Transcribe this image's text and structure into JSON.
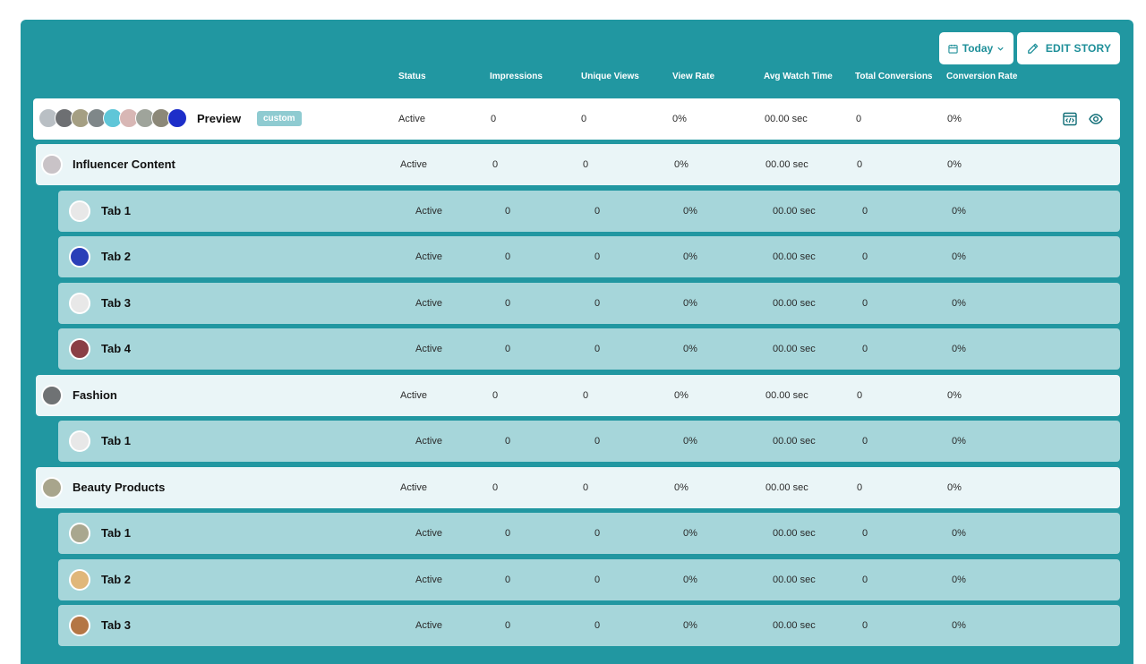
{
  "toolbar": {
    "date_label": "Today",
    "edit_label": "EDIT STORY"
  },
  "columns": [
    "Status",
    "Impressions",
    "Unique Views",
    "View Rate",
    "Avg Watch Time",
    "Total Conversions",
    "Conversion Rate"
  ],
  "colors": {
    "panel": "#2197a1",
    "group_row": "#eaf5f7",
    "tab_row": "#a6d6da",
    "accent": "#1e8f99"
  },
  "preview": {
    "name": "Preview",
    "badge": "custom",
    "status": "Active",
    "impressions": "0",
    "unique_views": "0",
    "view_rate": "0%",
    "avg_watch": "00.00 sec",
    "total_conv": "0",
    "conv_rate": "0%"
  },
  "rows": [
    {
      "kind": "group",
      "name": "Influencer Content",
      "status": "Active",
      "impressions": "0",
      "unique_views": "0",
      "view_rate": "0%",
      "avg_watch": "00.00 sec",
      "total_conv": "0",
      "conv_rate": "0%"
    },
    {
      "kind": "tab",
      "name": "Tab 1",
      "status": "Active",
      "impressions": "0",
      "unique_views": "0",
      "view_rate": "0%",
      "avg_watch": "00.00 sec",
      "total_conv": "0",
      "conv_rate": "0%"
    },
    {
      "kind": "tab",
      "name": "Tab 2",
      "status": "Active",
      "impressions": "0",
      "unique_views": "0",
      "view_rate": "0%",
      "avg_watch": "00.00 sec",
      "total_conv": "0",
      "conv_rate": "0%"
    },
    {
      "kind": "tab",
      "name": "Tab 3",
      "status": "Active",
      "impressions": "0",
      "unique_views": "0",
      "view_rate": "0%",
      "avg_watch": "00.00 sec",
      "total_conv": "0",
      "conv_rate": "0%"
    },
    {
      "kind": "tab",
      "name": "Tab 4",
      "status": "Active",
      "impressions": "0",
      "unique_views": "0",
      "view_rate": "0%",
      "avg_watch": "00.00 sec",
      "total_conv": "0",
      "conv_rate": "0%"
    },
    {
      "kind": "group",
      "name": "Fashion",
      "status": "Active",
      "impressions": "0",
      "unique_views": "0",
      "view_rate": "0%",
      "avg_watch": "00.00 sec",
      "total_conv": "0",
      "conv_rate": "0%"
    },
    {
      "kind": "tab",
      "name": "Tab 1",
      "status": "Active",
      "impressions": "0",
      "unique_views": "0",
      "view_rate": "0%",
      "avg_watch": "00.00 sec",
      "total_conv": "0",
      "conv_rate": "0%"
    },
    {
      "kind": "group",
      "name": "Beauty Products",
      "status": "Active",
      "impressions": "0",
      "unique_views": "0",
      "view_rate": "0%",
      "avg_watch": "00.00 sec",
      "total_conv": "0",
      "conv_rate": "0%"
    },
    {
      "kind": "tab",
      "name": "Tab 1",
      "status": "Active",
      "impressions": "0",
      "unique_views": "0",
      "view_rate": "0%",
      "avg_watch": "00.00 sec",
      "total_conv": "0",
      "conv_rate": "0%"
    },
    {
      "kind": "tab",
      "name": "Tab 2",
      "status": "Active",
      "impressions": "0",
      "unique_views": "0",
      "view_rate": "0%",
      "avg_watch": "00.00 sec",
      "total_conv": "0",
      "conv_rate": "0%"
    },
    {
      "kind": "tab",
      "name": "Tab 3",
      "status": "Active",
      "impressions": "0",
      "unique_views": "0",
      "view_rate": "0%",
      "avg_watch": "00.00 sec",
      "total_conv": "0",
      "conv_rate": "0%"
    }
  ]
}
